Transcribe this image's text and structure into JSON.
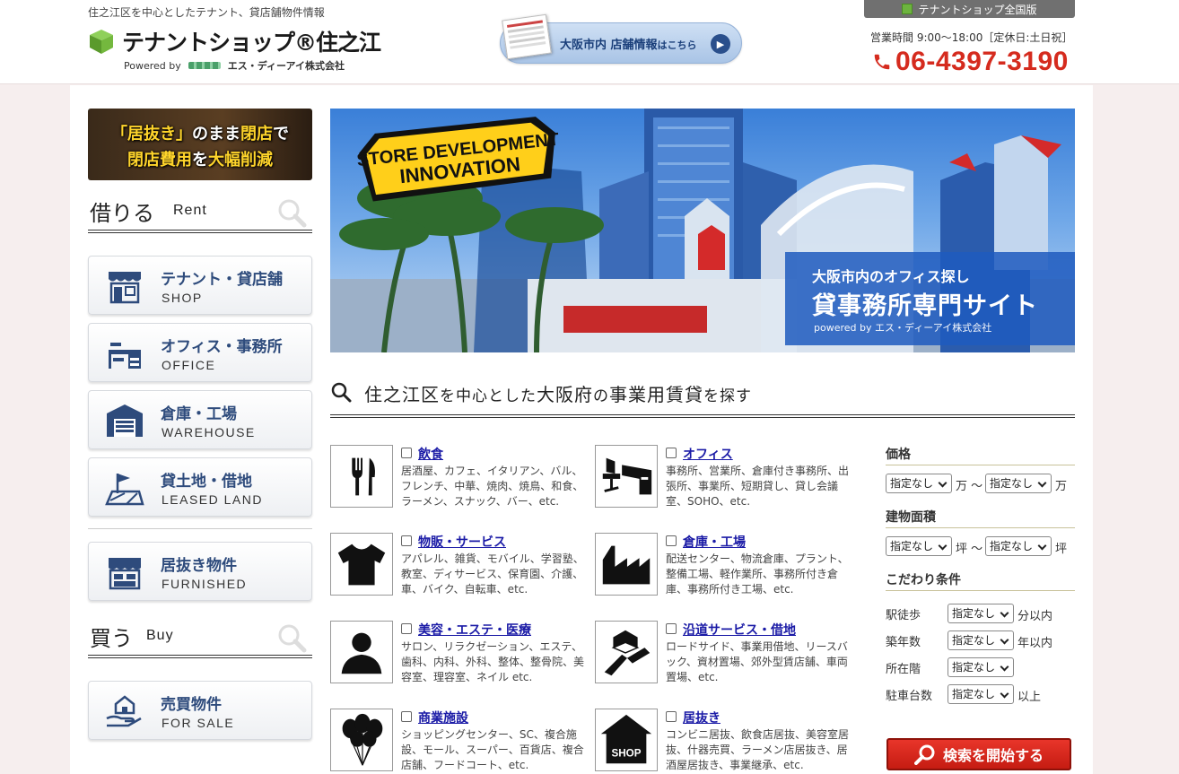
{
  "header": {
    "tagline": "住之江区を中心としたテナント、貸店舗物件情報",
    "logo_title": "テナントショップ®住之江",
    "powered_by": "Powered by",
    "company": "エス・ディーアイ株式会社",
    "osaka_banner": {
      "main": "大阪市内 店舗情報",
      "suffix": "はこちら"
    },
    "nation_tab": "テナントショップ全国版",
    "hours": "営業時間 9:00〜18:00［定休日:土日祝］",
    "phone": "06-4397-3190"
  },
  "sidebar": {
    "closing_banner": {
      "line1_a": "「居抜き」",
      "line1_b": "のまま",
      "line1_c": "閉店",
      "line1_d": "で",
      "line2_a": "閉店費用",
      "line2_b": "を",
      "line2_c": "大幅削減"
    },
    "rent": {
      "jp": "借りる",
      "en": "Rent"
    },
    "buy": {
      "jp": "買う",
      "en": "Buy"
    },
    "items": [
      {
        "jp": "テナント・貸店舗",
        "en": "SHOP"
      },
      {
        "jp": "オフィス・事務所",
        "en": "OFFICE"
      },
      {
        "jp": "倉庫・工場",
        "en": "WAREHOUSE"
      },
      {
        "jp": "貸土地・借地",
        "en": "LEASED LAND"
      },
      {
        "jp": "居抜き物件",
        "en": "FURNISHED"
      },
      {
        "jp": "売買物件",
        "en": "FOR SALE"
      }
    ]
  },
  "hero": {
    "badge_line1": "STORE DEVELOPMENT",
    "badge_line2": "INNOVATION",
    "line1": "大阪市内のオフィス探し",
    "line2": "貸事務所専門サイト",
    "line3": "powered by エス・ディーアイ株式会社"
  },
  "search": {
    "title_a": "住之江区",
    "title_b": "を中心とした",
    "title_c": "大阪府",
    "title_d": "の",
    "title_e": "事業用賃貸",
    "title_f": "を探す"
  },
  "categories": [
    {
      "name": "飲食",
      "desc": "居酒屋、カフェ、イタリアン、バル、フレンチ、中華、焼肉、焼鳥、和食、ラーメン、スナック、バー、etc."
    },
    {
      "name": "オフィス",
      "desc": "事務所、営業所、倉庫付き事務所、出張所、事業所、短期貸し、貸し会議室、SOHO、etc."
    },
    {
      "name": "物販・サービス",
      "desc": "アパレル、雑貨、モバイル、学習塾、教室、ディサービス、保育園、介護、車、バイク、自転車、etc."
    },
    {
      "name": "倉庫・工場",
      "desc": "配送センター、物流倉庫、プラント、整備工場、軽作業所、事務所付き倉庫、事務所付き工場、etc."
    },
    {
      "name": "美容・エステ・医療",
      "desc": "サロン、リラクゼーション、エステ、歯科、内科、外科、整体、整骨院、美容室、理容室、ネイル etc."
    },
    {
      "name": "沿道サービス・借地",
      "desc": "ロードサイド、事業用借地、リースバック、資材置場、郊外型賃店舗、車両置場、etc."
    },
    {
      "name": "商業施設",
      "desc": "ショッピングセンター、SC、複合施設、モール、スーパー、百貨店、複合店舗、フードコート、etc."
    },
    {
      "name": "居抜き",
      "desc": "コンビニ居抜、飲食店居抜、美容室居抜、什器売買、ラーメン店居抜き、居酒屋居抜き、事業継承、etc."
    }
  ],
  "filters": {
    "price": {
      "label": "価格",
      "from": "指定なし",
      "to": "指定なし",
      "unit1": "万 〜",
      "unit2": "万"
    },
    "area": {
      "label": "建物面積",
      "from": "指定なし",
      "to": "指定なし",
      "unit1": "坪 〜",
      "unit2": "坪"
    },
    "kodawari": "こだわり条件",
    "walk": {
      "label": "駅徒歩",
      "value": "指定なし",
      "unit": "分以内"
    },
    "age": {
      "label": "築年数",
      "value": "指定なし",
      "unit": "年以内"
    },
    "floor": {
      "label": "所在階",
      "value": "指定なし"
    },
    "parking": {
      "label": "駐車台数",
      "value": "指定なし",
      "unit": "以上"
    },
    "search_button": "検索を開始する"
  },
  "colors": {
    "accent_red": "#d52b1e",
    "nav_blue": "#2e4b7c",
    "link_blue": "#1a1aa6",
    "logo_green": "#6db33f"
  },
  "icons": [
    "cube-logo-icon",
    "phone-icon",
    "magnifier-icon",
    "shop-icon",
    "office-icon",
    "warehouse-icon",
    "land-icon",
    "furnished-icon",
    "for-sale-icon",
    "fork-knife-icon",
    "desk-icon",
    "tshirt-icon",
    "factory-icon",
    "person-icon",
    "road-icon",
    "balloon-icon",
    "shop-house-icon"
  ]
}
